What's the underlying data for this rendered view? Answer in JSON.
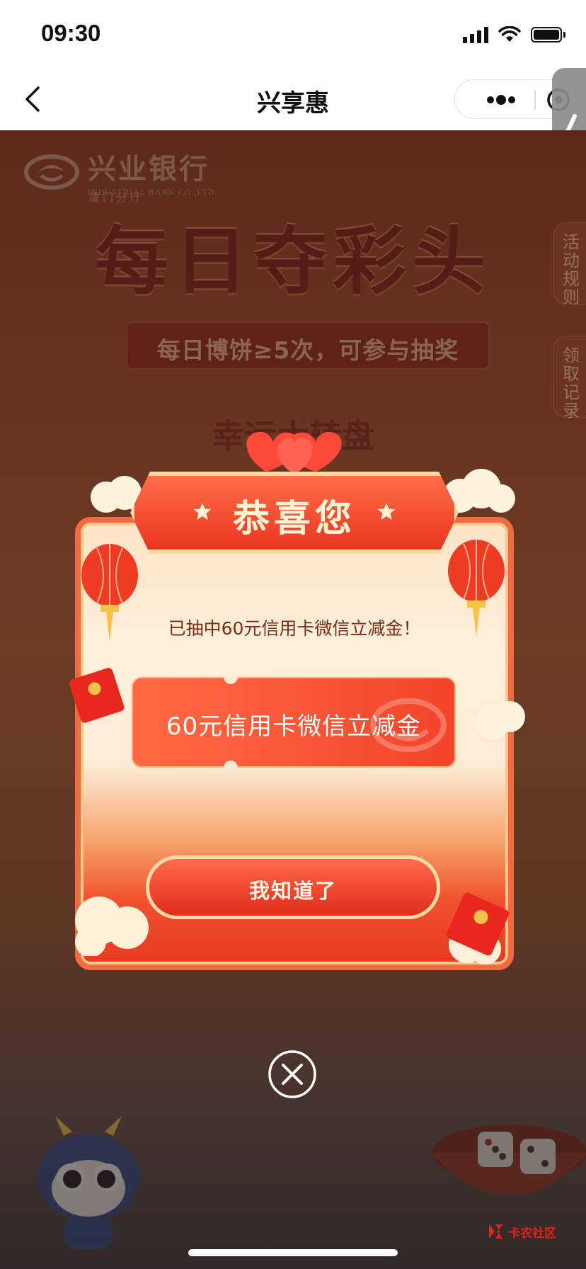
{
  "status_bar": {
    "time": "09:30"
  },
  "nav": {
    "title": "兴享惠"
  },
  "game": {
    "bank_name": "兴业银行",
    "bank_name_en": "INDUSTRIAL BANK CO.,LTD.",
    "bank_branch": "厦门分行",
    "title": "每日夺彩头",
    "banner": "每日博饼≥5次，可参与抽奖",
    "wheel_label": "幸运大转盘",
    "side_tabs": [
      {
        "label": "活动规则"
      },
      {
        "label": "领取记录"
      }
    ]
  },
  "modal": {
    "title": "恭喜您",
    "message": "已抽中60元信用卡微信立减金！",
    "prize": "60元信用卡微信立减金",
    "confirm_label": "我知道了"
  },
  "watermark": {
    "name": "卡农社区"
  },
  "colors": {
    "primary_red": "#e93a22",
    "cream": "#fdf0dc",
    "gold": "#ffd89c",
    "text_brown": "#7b2c18"
  }
}
